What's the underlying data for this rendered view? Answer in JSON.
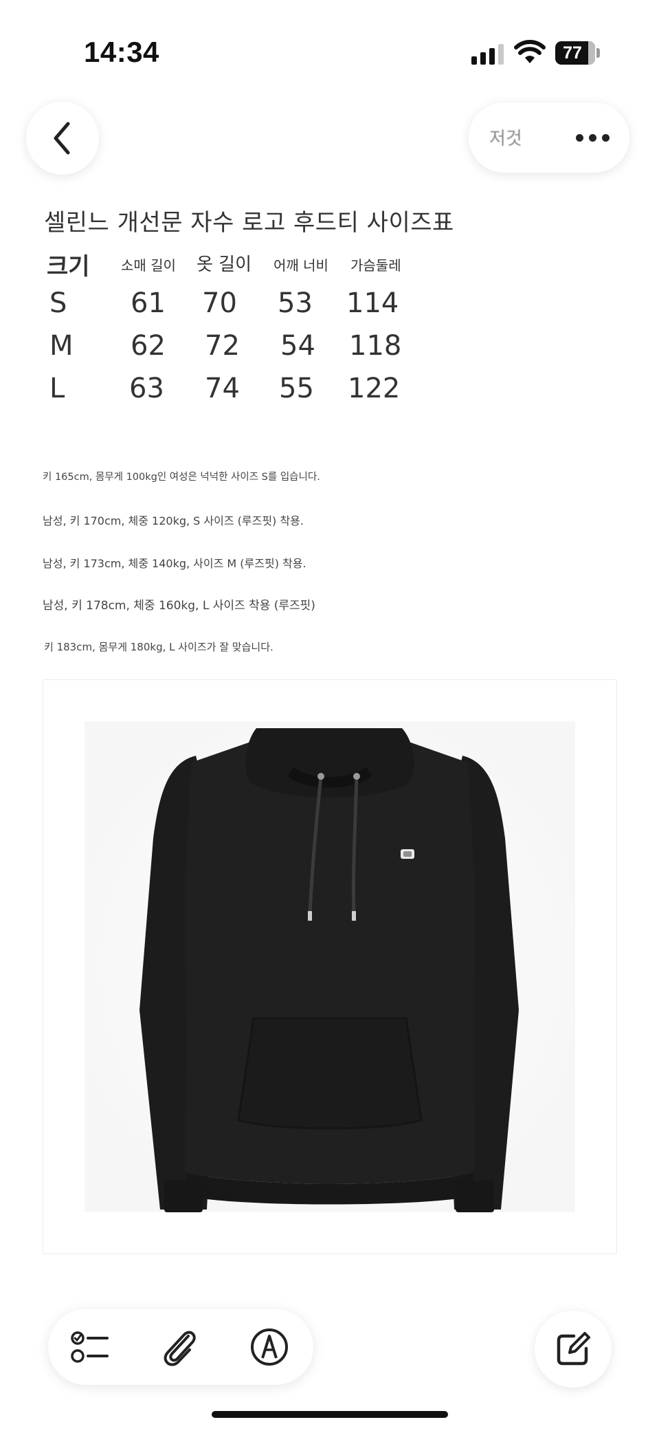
{
  "status_bar": {
    "time": "14:34",
    "battery": "77",
    "icons": [
      "cellular-signal-icon",
      "wifi-icon",
      "battery-icon"
    ]
  },
  "nav": {
    "back_icon": "chevron-left-icon",
    "pill_label": "저것",
    "more_icon": "ellipsis-icon"
  },
  "note": {
    "title": "셀린느 개선문 자수 로고 후드티 사이즈표",
    "size_table": {
      "headers": [
        "크기",
        "소매 길이",
        "옷 길이",
        "어깨 너비",
        "가슴둘레"
      ],
      "rows": [
        [
          "S",
          "61",
          "70",
          "53",
          "114"
        ],
        [
          "M",
          "62",
          "72",
          "54",
          "118"
        ],
        [
          "L",
          "63",
          "74",
          "55",
          "122"
        ]
      ]
    },
    "fit_notes": [
      "키 165cm, 몸무게 100kg인 여성은 넉넉한 사이즈 S를 입습니다.",
      "남성, 키 170cm, 체중 120kg, S 사이즈 (루즈핏) 착용.",
      "남성, 키 173cm, 체중 140kg, 사이즈 M (루즈핏) 착용.",
      "남성, 키 178cm, 체중 160kg, L 사이즈 착용 (루즈핏)",
      "키 183cm, 몸무게 180kg, L 사이즈가 잘 맞습니다."
    ]
  },
  "toolbar": {
    "icons": [
      "checklist-icon",
      "paperclip-icon",
      "markup-pen-icon"
    ],
    "compose_icon": "compose-icon"
  },
  "colors": {
    "hoodie": "#1e1e1e",
    "background": "#ffffff",
    "text": "#333333"
  }
}
